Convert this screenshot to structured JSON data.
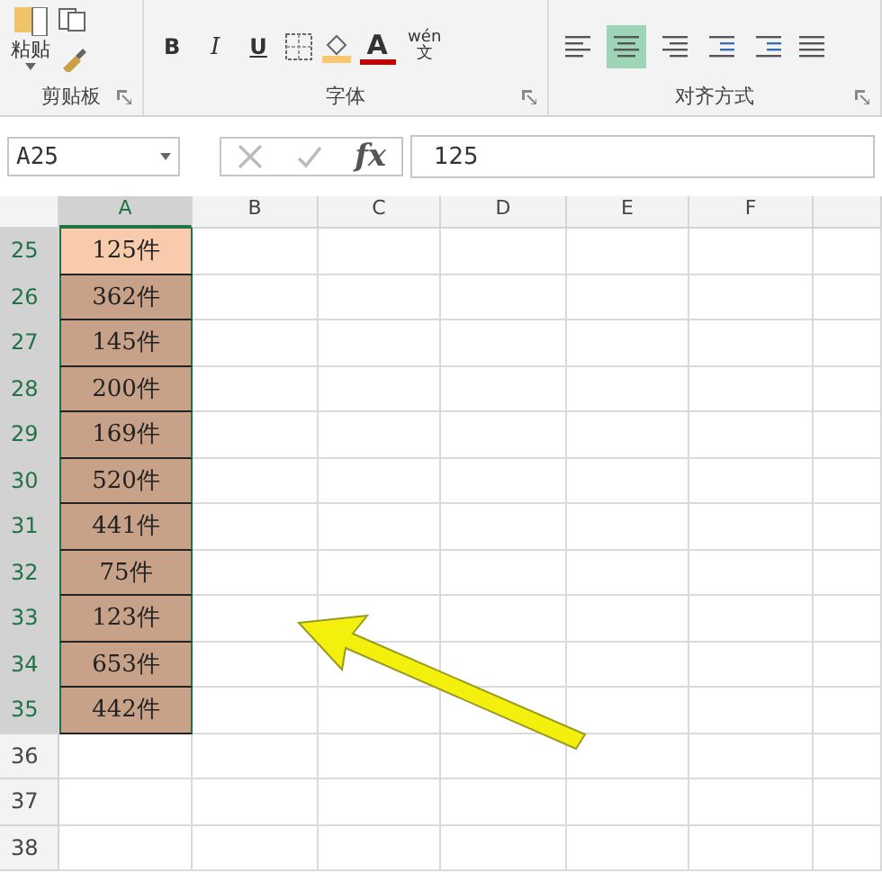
{
  "ribbon": {
    "groups": [
      {
        "label": "剪贴板",
        "paste_label": "粘贴"
      },
      {
        "label": "字体",
        "buttons": [
          {
            "kind": "bold",
            "text": "B"
          },
          {
            "kind": "italic",
            "text": "I"
          },
          {
            "kind": "underline",
            "text": "U"
          },
          {
            "kind": "border"
          },
          {
            "kind": "fill"
          },
          {
            "kind": "fontcolor",
            "text": "A"
          },
          {
            "kind": "phonetic",
            "text": "wén",
            "sub": "文"
          }
        ]
      },
      {
        "label": "对齐方式",
        "buttons": [
          {
            "kind": "left",
            "selected": false
          },
          {
            "kind": "center",
            "selected": true
          },
          {
            "kind": "right",
            "selected": false
          },
          {
            "kind": "outdent",
            "selected": false
          },
          {
            "kind": "indent",
            "selected": false
          },
          {
            "kind": "merge",
            "selected": false
          }
        ]
      }
    ]
  },
  "formula_bar": {
    "name_box": "A25",
    "fx": "fx",
    "value": "125"
  },
  "sheet": {
    "columns": [
      {
        "label": "A",
        "selected": true
      },
      {
        "label": "B",
        "selected": false
      },
      {
        "label": "C",
        "selected": false
      },
      {
        "label": "D",
        "selected": false
      },
      {
        "label": "E",
        "selected": false
      },
      {
        "label": "F",
        "selected": false
      },
      {
        "selected": false
      }
    ],
    "rows": [
      {
        "number": "25",
        "value": "125件",
        "selected": true,
        "active": true
      },
      {
        "number": "26",
        "value": "362件",
        "selected": true,
        "active": false
      },
      {
        "number": "27",
        "value": "145件",
        "selected": true,
        "active": false
      },
      {
        "number": "28",
        "value": "200件",
        "selected": true,
        "active": false
      },
      {
        "number": "29",
        "value": "169件",
        "selected": true,
        "active": false
      },
      {
        "number": "30",
        "value": "520件",
        "selected": true,
        "active": false
      },
      {
        "number": "31",
        "value": "441件",
        "selected": true,
        "active": false
      },
      {
        "number": "32",
        "value": "75件",
        "selected": true,
        "active": false
      },
      {
        "number": "33",
        "value": "123件",
        "selected": true,
        "active": false
      },
      {
        "number": "34",
        "value": "653件",
        "selected": true,
        "active": false
      },
      {
        "number": "35",
        "value": "442件",
        "selected": true,
        "active": false
      },
      {
        "number": "36",
        "selected": false,
        "active": false
      },
      {
        "number": "37",
        "selected": false,
        "active": false
      },
      {
        "number": "38",
        "selected": false,
        "active": false
      }
    ]
  }
}
